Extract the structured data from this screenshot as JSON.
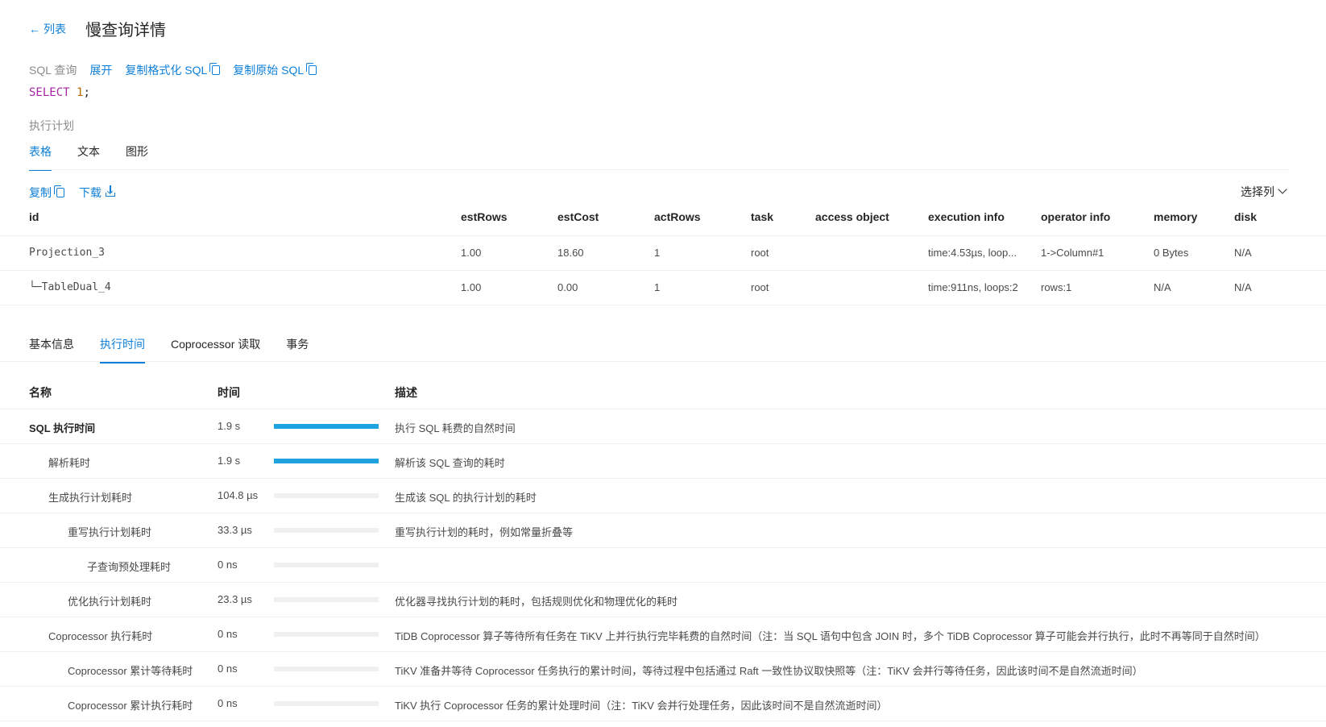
{
  "header": {
    "back_label": "列表",
    "title": "慢查询详情"
  },
  "sql_section": {
    "label": "SQL 查询",
    "expand": "展开",
    "copy_formatted": "复制格式化 SQL",
    "copy_original": "复制原始 SQL",
    "keyword": "SELECT",
    "number": "1",
    "tail": ";"
  },
  "plan": {
    "label": "执行计划",
    "tabs": [
      "表格",
      "文本",
      "图形"
    ],
    "active_tab": 0,
    "copy": "复制",
    "download": "下载",
    "select_columns": "选择列",
    "columns": [
      "id",
      "estRows",
      "estCost",
      "actRows",
      "task",
      "access object",
      "execution info",
      "operator info",
      "memory",
      "disk"
    ],
    "rows": [
      [
        "Projection_3",
        "1.00",
        "18.60",
        "1",
        "root",
        "",
        "time:4.53µs, loop...",
        "1->Column#1",
        "0 Bytes",
        "N/A"
      ],
      [
        "└─TableDual_4",
        "1.00",
        "0.00",
        "1",
        "root",
        "",
        "time:911ns, loops:2",
        "rows:1",
        "N/A",
        "N/A"
      ]
    ]
  },
  "detail": {
    "tabs": [
      "基本信息",
      "执行时间",
      "Coprocessor 读取",
      "事务"
    ],
    "active_tab": 1,
    "columns": [
      "名称",
      "时间",
      "描述"
    ],
    "rows": [
      {
        "name": "SQL 执行时间",
        "time": "1.9 s",
        "bar": 1.0,
        "desc": "执行 SQL 耗费的自然时间",
        "level": 0,
        "bold": true
      },
      {
        "name": "解析耗时",
        "time": "1.9 s",
        "bar": 1.0,
        "desc": "解析该 SQL 查询的耗时",
        "level": 1
      },
      {
        "name": "生成执行计划耗时",
        "time": "104.8 µs",
        "bar": 0,
        "desc": "生成该 SQL 的执行计划的耗时",
        "level": 1
      },
      {
        "name": "重写执行计划耗时",
        "time": "33.3 µs",
        "bar": 0,
        "desc": "重写执行计划的耗时，例如常量折叠等",
        "level": 2
      },
      {
        "name": "子查询预处理耗时",
        "time": "0 ns",
        "bar": 0,
        "desc": "",
        "level": 3
      },
      {
        "name": "优化执行计划耗时",
        "time": "23.3 µs",
        "bar": 0,
        "desc": "优化器寻找执行计划的耗时，包括规则优化和物理优化的耗时",
        "level": 2
      },
      {
        "name": "Coprocessor 执行耗时",
        "time": "0 ns",
        "bar": 0,
        "desc": "TiDB Coprocessor 算子等待所有任务在 TiKV 上并行执行完毕耗费的自然时间（注：当 SQL 语句中包含 JOIN 时，多个 TiDB Coprocessor 算子可能会并行执行，此时不再等同于自然时间）",
        "level": 1
      },
      {
        "name": "Coprocessor 累计等待耗时",
        "time": "0 ns",
        "bar": 0,
        "desc": "TiKV 准备并等待 Coprocessor 任务执行的累计时间，等待过程中包括通过 Raft 一致性协议取快照等（注：TiKV 会并行等待任务，因此该时间不是自然流逝时间）",
        "level": 2
      },
      {
        "name": "Coprocessor 累计执行耗时",
        "time": "0 ns",
        "bar": 0,
        "desc": "TiKV 执行 Coprocessor 任务的累计处理时间（注：TiKV 会并行处理任务，因此该时间不是自然流逝时间）",
        "level": 2
      }
    ]
  },
  "colors": {
    "accent": "#0d7fd8",
    "bar": "#1fa3e0"
  }
}
